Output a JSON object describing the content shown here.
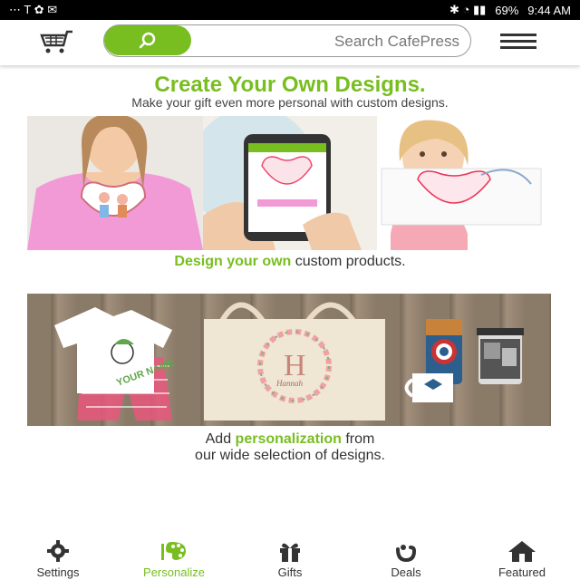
{
  "status": {
    "time": "9:44 AM",
    "battery": "69%",
    "left_icons": "⋯  T  ✿  ✉",
    "right_icons": "✱ ◔ ▮▮"
  },
  "header": {
    "search_placeholder": "Search CafePress"
  },
  "hero": {
    "title": "Create Your Own Designs.",
    "subtitle": "Make your gift even more personal with custom designs.",
    "caption_highlight": "Design your own",
    "caption_rest": "custom products."
  },
  "products": {
    "caption_prefix": "Add",
    "caption_highlight": "personalization",
    "caption_line1_rest": "from",
    "caption_line2": "our wide selection of designs.",
    "tshirt_text": "YOUR NAME",
    "tote_monogram": "H",
    "tote_script": "Hannah"
  },
  "bottom_nav": [
    {
      "label": "Featured",
      "icon": "home-icon"
    },
    {
      "label": "Deals",
      "icon": "deals-icon"
    },
    {
      "label": "Gifts",
      "icon": "gift-icon"
    },
    {
      "label": "Personalize",
      "icon": "palette-icon"
    },
    {
      "label": "Settings",
      "icon": "gear-icon"
    }
  ],
  "colors": {
    "accent": "#78be20"
  }
}
